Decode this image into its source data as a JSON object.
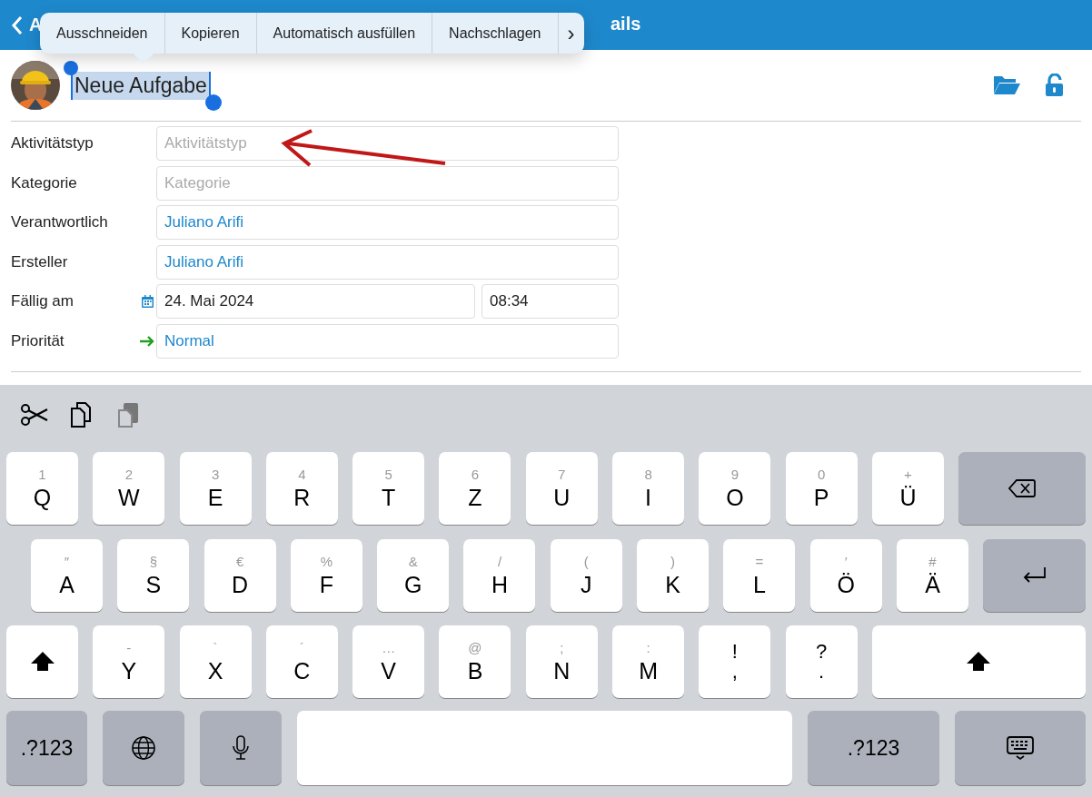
{
  "nav_bar": {
    "back_label": "A",
    "title": "ails"
  },
  "context_menu": {
    "items": [
      "Ausschneiden",
      "Kopieren",
      "Automatisch ausfüllen",
      "Nachschlagen"
    ],
    "more": "›"
  },
  "task": {
    "title": "Neue Aufgabe",
    "selected": true
  },
  "form": {
    "rows": [
      {
        "kind": "text",
        "label": "Aktivitätstyp",
        "placeholder": "Aktivitätstyp"
      },
      {
        "kind": "text",
        "label": "Kategorie",
        "placeholder": "Kategorie"
      },
      {
        "kind": "person",
        "label": "Verantwortlich",
        "value": "Juliano Arifi"
      },
      {
        "kind": "person",
        "label": "Ersteller",
        "value": "Juliano Arifi"
      },
      {
        "kind": "date",
        "label": "Fällig am",
        "value": "24. Mai 2024",
        "time": "08:34"
      },
      {
        "kind": "priority",
        "label": "Priorität",
        "value": "Normal"
      }
    ]
  },
  "keyboard": {
    "rows": [
      [
        {
          "kind": "letter",
          "alt": "1",
          "main": "Q"
        },
        {
          "kind": "letter",
          "alt": "2",
          "main": "W"
        },
        {
          "kind": "letter",
          "alt": "3",
          "main": "E"
        },
        {
          "kind": "letter",
          "alt": "4",
          "main": "R"
        },
        {
          "kind": "letter",
          "alt": "5",
          "main": "T"
        },
        {
          "kind": "letter",
          "alt": "6",
          "main": "Z"
        },
        {
          "kind": "letter",
          "alt": "7",
          "main": "U"
        },
        {
          "kind": "letter",
          "alt": "8",
          "main": "I"
        },
        {
          "kind": "letter",
          "alt": "9",
          "main": "O"
        },
        {
          "kind": "letter",
          "alt": "0",
          "main": "P"
        },
        {
          "kind": "letter",
          "alt": "+",
          "main": "Ü"
        },
        {
          "kind": "backspace"
        }
      ],
      [
        {
          "kind": "letter",
          "alt": "″",
          "main": "A"
        },
        {
          "kind": "letter",
          "alt": "§",
          "main": "S"
        },
        {
          "kind": "letter",
          "alt": "€",
          "main": "D"
        },
        {
          "kind": "letter",
          "alt": "%",
          "main": "F"
        },
        {
          "kind": "letter",
          "alt": "&",
          "main": "G"
        },
        {
          "kind": "letter",
          "alt": "/",
          "main": "H"
        },
        {
          "kind": "letter",
          "alt": "(",
          "main": "J"
        },
        {
          "kind": "letter",
          "alt": ")",
          "main": "K"
        },
        {
          "kind": "letter",
          "alt": "=",
          "main": "L"
        },
        {
          "kind": "letter",
          "alt": "′",
          "main": "Ö"
        },
        {
          "kind": "letter",
          "alt": "#",
          "main": "Ä"
        },
        {
          "kind": "return"
        }
      ],
      [
        {
          "kind": "shift"
        },
        {
          "kind": "letter",
          "alt": "-",
          "main": "Y"
        },
        {
          "kind": "letter",
          "alt": "`",
          "main": "X"
        },
        {
          "kind": "letter",
          "alt": "´",
          "main": "C"
        },
        {
          "kind": "letter",
          "alt": "…",
          "main": "V"
        },
        {
          "kind": "letter",
          "alt": "@",
          "main": "B"
        },
        {
          "kind": "letter",
          "alt": ";",
          "main": "N"
        },
        {
          "kind": "letter",
          "alt": ":",
          "main": "M"
        },
        {
          "kind": "punct",
          "alt": "!",
          "main": ","
        },
        {
          "kind": "punct",
          "alt": "?",
          "main": "."
        },
        {
          "kind": "shift"
        }
      ],
      [
        {
          "kind": "mode",
          "main": ".?123"
        },
        {
          "kind": "globe"
        },
        {
          "kind": "mic"
        },
        {
          "kind": "space"
        },
        {
          "kind": "mode",
          "main": ".?123"
        },
        {
          "kind": "hide"
        }
      ]
    ]
  }
}
